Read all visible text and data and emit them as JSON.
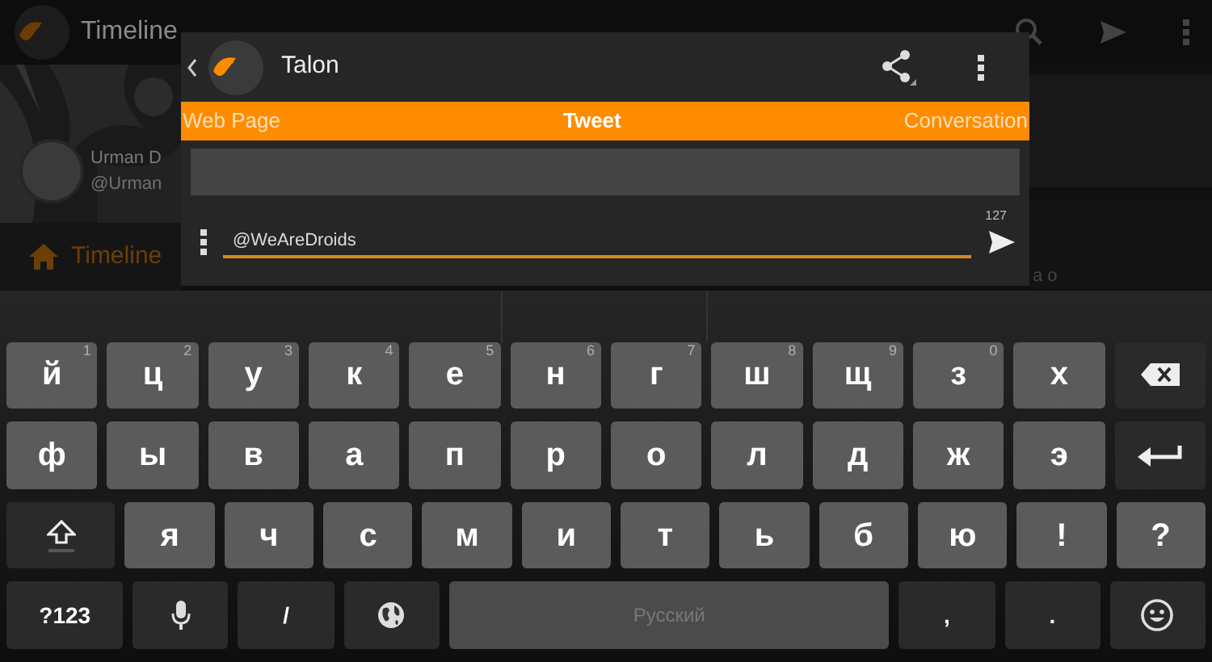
{
  "background_app": {
    "title": "Timeline",
    "user_name": "Urman D",
    "user_handle": "@Urman",
    "nav_item": "Timeline",
    "snippet": "а о"
  },
  "dialog": {
    "title": "Talon",
    "tabs": [
      {
        "label": "Web Page",
        "selected": false
      },
      {
        "label": "Tweet",
        "selected": true
      },
      {
        "label": "Conversation",
        "selected": false
      }
    ],
    "counter": "127",
    "compose": {
      "value": "@WeAreDroids"
    }
  },
  "keyboard": {
    "rows": [
      {
        "keys": [
          {
            "kind": "letter",
            "label": "й",
            "hint": "1"
          },
          {
            "kind": "letter",
            "label": "ц",
            "hint": "2"
          },
          {
            "kind": "letter",
            "label": "у",
            "hint": "3"
          },
          {
            "kind": "letter",
            "label": "к",
            "hint": "4"
          },
          {
            "kind": "letter",
            "label": "е",
            "hint": "5"
          },
          {
            "kind": "letter",
            "label": "н",
            "hint": "6"
          },
          {
            "kind": "letter",
            "label": "г",
            "hint": "7"
          },
          {
            "kind": "letter",
            "label": "ш",
            "hint": "8"
          },
          {
            "kind": "letter",
            "label": "щ",
            "hint": "9"
          },
          {
            "kind": "letter",
            "label": "з",
            "hint": "0"
          },
          {
            "kind": "letter",
            "label": "х"
          },
          {
            "kind": "backspace"
          }
        ]
      },
      {
        "keys": [
          {
            "kind": "letter",
            "label": "ф"
          },
          {
            "kind": "letter",
            "label": "ы"
          },
          {
            "kind": "letter",
            "label": "в"
          },
          {
            "kind": "letter",
            "label": "а"
          },
          {
            "kind": "letter",
            "label": "п"
          },
          {
            "kind": "letter",
            "label": "р"
          },
          {
            "kind": "letter",
            "label": "о"
          },
          {
            "kind": "letter",
            "label": "л"
          },
          {
            "kind": "letter",
            "label": "д"
          },
          {
            "kind": "letter",
            "label": "ж"
          },
          {
            "kind": "letter",
            "label": "э"
          },
          {
            "kind": "enter"
          }
        ]
      },
      {
        "keys": [
          {
            "kind": "shift"
          },
          {
            "kind": "letter",
            "label": "я"
          },
          {
            "kind": "letter",
            "label": "ч"
          },
          {
            "kind": "letter",
            "label": "с"
          },
          {
            "kind": "letter",
            "label": "м"
          },
          {
            "kind": "letter",
            "label": "и"
          },
          {
            "kind": "letter",
            "label": "т"
          },
          {
            "kind": "letter",
            "label": "ь"
          },
          {
            "kind": "letter",
            "label": "б"
          },
          {
            "kind": "letter",
            "label": "ю"
          },
          {
            "kind": "letter",
            "label": "!"
          },
          {
            "kind": "letter",
            "label": "?"
          }
        ]
      },
      {
        "keys": [
          {
            "kind": "function",
            "label": "?123"
          },
          {
            "kind": "mic"
          },
          {
            "kind": "function",
            "label": "/"
          },
          {
            "kind": "globe"
          },
          {
            "kind": "space",
            "label": "Русский"
          },
          {
            "kind": "function",
            "label": ","
          },
          {
            "kind": "function",
            "label": "."
          },
          {
            "kind": "emoji"
          }
        ]
      }
    ]
  }
}
